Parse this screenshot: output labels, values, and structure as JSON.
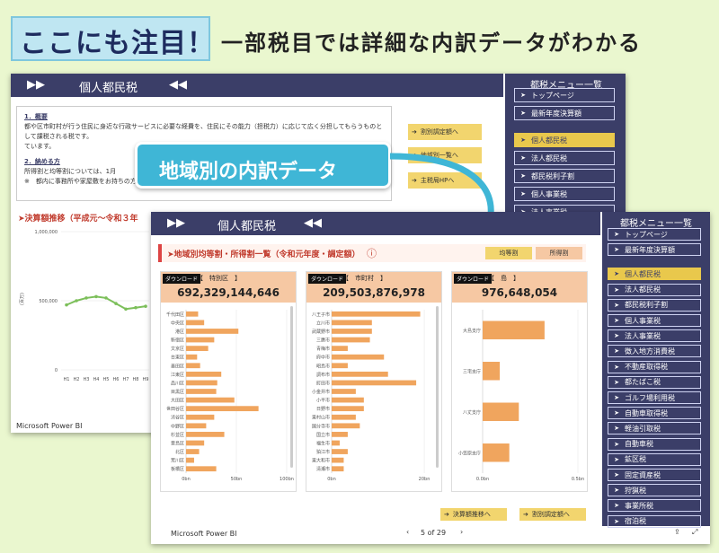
{
  "headline": {
    "box_text": "ここにも注目！",
    "rest_text": "一部税目では詳細な内訳データがわかる"
  },
  "back": {
    "band_left": "▶▶",
    "band_title": "個人都民税",
    "band_right": "◀◀",
    "doc": {
      "h1": "1．概要",
      "p1": "都や区市町村が行う住民に身近な行政サービスに必要な経費を、住民にその能力（担税力）に応じて広く分担してもらうものとして課税される税です。",
      "p1b": "ています。",
      "h2": "2．納める方",
      "p2": "所得割と均等割については、1月",
      "p3": "※　都内に事務所や家屋敷をお持ちの方で、その区市町村に住所がない場合には、均等割だけが課税されます。"
    },
    "buttons": [
      "割別調定額へ",
      "地域別一覧へ",
      "主税局HPへ"
    ],
    "trend_title": "➤決算額推移（平成元〜令和３年",
    "y_ticks": [
      "1,000,000",
      "500,000",
      "0"
    ],
    "y_unit": "(百万)",
    "x_ticks": [
      "H1",
      "H2",
      "H3",
      "H4",
      "H5",
      "H6",
      "H7",
      "H8",
      "H9"
    ],
    "pbi": "Microsoft Power BI",
    "side_title": "都税メニュー一覧",
    "side_items": [
      "トップページ",
      "最新年度決算額",
      "個人都民税",
      "法人都民税",
      "都民税利子割",
      "個人事業税",
      "法人事業税"
    ]
  },
  "callout": "地域別の内訳データ",
  "front": {
    "band_left": "▶▶",
    "band_title": "個人都民税",
    "band_right": "◀◀",
    "section_title": "➤地域別均等割・所得割一覧（令和元年度・調定額）",
    "info_icon": "ⓘ",
    "toggles": [
      "均等割",
      "所得割"
    ],
    "download_label": "ダウンロード",
    "cols": [
      {
        "category": "【　特別区　】",
        "total": "692,329,144,646",
        "labels": [
          "千代田区",
          "中央区",
          "港区",
          "新宿区",
          "文京区",
          "台東区",
          "墨田区",
          "江東区",
          "品川区",
          "目黒区",
          "大田区",
          "世田谷区",
          "渋谷区",
          "中野区",
          "杉並区",
          "豊島区",
          "北区",
          "荒川区",
          "板橋区"
        ],
        "axis": [
          "0bn",
          "50bn",
          "100bn"
        ]
      },
      {
        "category": "【　市町村　】",
        "total": "209,503,876,978",
        "labels": [
          "八王子市",
          "立川市",
          "武蔵野市",
          "三鷹市",
          "青梅市",
          "府中市",
          "昭島市",
          "調布市",
          "町田市",
          "小金井市",
          "小平市",
          "日野市",
          "東村山市",
          "国分寺市",
          "国立市",
          "福生市",
          "狛江市",
          "東大和市",
          "清瀬市"
        ],
        "axis": [
          "0bn",
          "20bn"
        ]
      },
      {
        "category": "【　島　】",
        "total": "976,648,054",
        "labels": [
          "大島支庁",
          "三宅支庁",
          "八丈支庁",
          "小笠原支庁"
        ],
        "axis": [
          "0.0bn",
          "0.5bn"
        ]
      }
    ],
    "bottom_buttons": [
      "決算額推移へ",
      "割別調定額へ"
    ],
    "pbi": "Microsoft Power BI",
    "pager": "5 of 29",
    "side_title": "都税メニュー一覧",
    "side_items": [
      "トップページ",
      "最新年度決算額",
      "個人都民税",
      "法人都民税",
      "都民税利子割",
      "個人事業税",
      "法人事業税",
      "徴入地方消費税",
      "不動産取得税",
      "都たばこ税",
      "ゴルフ場利用税",
      "自動車取得税",
      "軽油引取税",
      "自動車税",
      "鉱区税",
      "固定資産税",
      "狩猟税",
      "事業所税",
      "宿泊税"
    ]
  },
  "chart_data": [
    {
      "type": "line",
      "title": "決算額推移（平成元〜令和３年",
      "ylabel": "(百万)",
      "categories": [
        "H1",
        "H2",
        "H3",
        "H4",
        "H5",
        "H6",
        "H7",
        "H8",
        "H9"
      ],
      "values": [
        470000,
        500000,
        520000,
        530000,
        520000,
        480000,
        440000,
        450000,
        460000
      ],
      "ylim": [
        0,
        1000000
      ]
    },
    {
      "type": "bar",
      "title": "特別区",
      "categories": [
        "千代田区",
        "中央区",
        "港区",
        "新宿区",
        "文京区",
        "台東区",
        "墨田区",
        "江東区",
        "品川区",
        "目黒区",
        "大田区",
        "世田谷区",
        "渋谷区",
        "中野区",
        "杉並区",
        "豊島区",
        "北区",
        "荒川区",
        "板橋区"
      ],
      "values": [
        12,
        18,
        52,
        28,
        22,
        11,
        14,
        35,
        31,
        30,
        48,
        72,
        28,
        20,
        38,
        18,
        13,
        8,
        30
      ],
      "xlim": [
        0,
        100
      ]
    },
    {
      "type": "bar",
      "title": "市町村",
      "categories": [
        "八王子市",
        "立川市",
        "武蔵野市",
        "三鷹市",
        "青梅市",
        "府中市",
        "昭島市",
        "調布市",
        "町田市",
        "小金井市",
        "小平市",
        "日野市",
        "東村山市",
        "国分寺市",
        "国立市",
        "福生市",
        "狛江市",
        "東大和市",
        "清瀬市"
      ],
      "values": [
        22,
        10,
        10,
        9.5,
        4,
        13,
        4,
        14,
        21,
        6,
        8,
        8,
        6,
        7,
        4,
        2,
        4,
        3,
        3
      ],
      "xlim": [
        0,
        25
      ]
    },
    {
      "type": "bar",
      "title": "島",
      "categories": [
        "大島支庁",
        "三宅支庁",
        "八丈支庁",
        "小笠原支庁"
      ],
      "values": [
        0.65,
        0.18,
        0.38,
        0.28
      ],
      "xlim": [
        0,
        1.0
      ]
    }
  ]
}
